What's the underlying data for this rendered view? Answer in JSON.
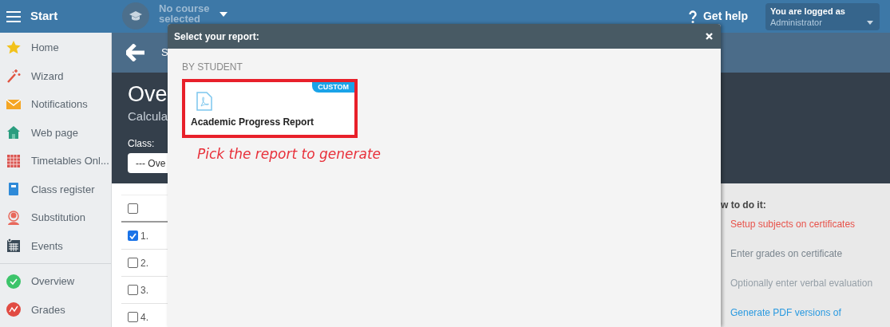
{
  "topbar": {
    "menu_label": "Start",
    "course": [
      "No course",
      "selected"
    ],
    "help": "Get help",
    "user": {
      "caption": "You are logged as",
      "name": "Administrator"
    }
  },
  "sidebar": {
    "groups": [
      [
        {
          "label": "Home",
          "kind": "star"
        },
        {
          "label": "Wizard",
          "kind": "wand"
        },
        {
          "label": "Notifications",
          "kind": "envelope"
        },
        {
          "label": "Web page",
          "kind": "house"
        },
        {
          "label": "Timetables Onl...",
          "kind": "grid"
        },
        {
          "label": "Class register",
          "kind": "book"
        },
        {
          "label": "Substitution",
          "kind": "person"
        },
        {
          "label": "Events",
          "kind": "calendar"
        }
      ],
      [
        {
          "label": "Overview",
          "kind": "check"
        },
        {
          "label": "Grades",
          "kind": "chart"
        }
      ]
    ]
  },
  "page": {
    "toolbar_text": "S",
    "title": "Ove",
    "subtitle": "Calcula",
    "class_label": "Class:",
    "class_value": "--- Ove",
    "select_all": {
      "checked": false
    },
    "rows": [
      {
        "label": "1.",
        "checked": true
      },
      {
        "label": "2.",
        "checked": false
      },
      {
        "label": "3.",
        "checked": false
      },
      {
        "label": "4.",
        "checked": false
      }
    ]
  },
  "help_panel": {
    "heading": "w to do it:",
    "steps": [
      {
        "text": "Setup subjects on certificates",
        "kind": "current"
      },
      {
        "text": "Enter grades on certificate",
        "kind": "normal"
      },
      {
        "text": "Optionally enter verbal evaluation",
        "kind": "muted"
      },
      {
        "text": "Generate PDF versions of",
        "kind": "link"
      }
    ]
  },
  "modal": {
    "title": "Select your report:",
    "section": "BY STUDENT",
    "reports": [
      {
        "title": "Academic Progress Report",
        "badge": "CUSTOM",
        "selected": true
      }
    ],
    "hint": "Pick the report to generate"
  }
}
